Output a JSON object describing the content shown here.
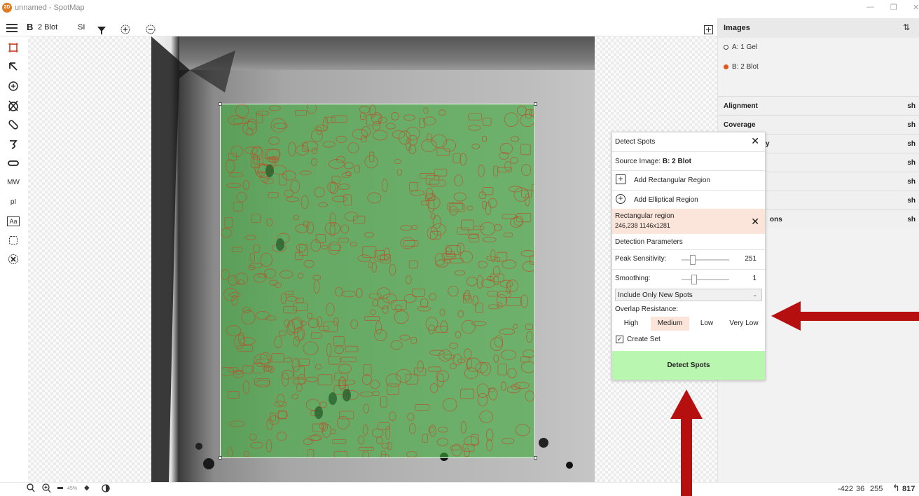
{
  "window": {
    "title": "unnamed - SpotMap",
    "logo_text": "2D",
    "minimize": "—",
    "maximize": "❐",
    "close": "✕"
  },
  "toolbar": {
    "image_letter": "B",
    "image_name": "2 Blot",
    "si_label": "SI"
  },
  "left_tools": {
    "mw_label": "MW",
    "pi_label": "pI",
    "text_label": "Aa"
  },
  "status_bar": {
    "zoom": "45%",
    "readout_x": "-422",
    "readout_y": "36",
    "readout_intensity": "255",
    "spot_count": "817"
  },
  "right_panel": {
    "images_header": "Images",
    "images": [
      {
        "label": "A: 1 Gel",
        "selected": false
      },
      {
        "label": "B: 2 Blot",
        "selected": true
      }
    ],
    "sections": [
      {
        "label": "Alignment",
        "short": "sh"
      },
      {
        "label": "Coverage",
        "short": "sh"
      },
      {
        "label": "y",
        "short": "sh"
      },
      {
        "label": "",
        "short": "sh"
      },
      {
        "label": "",
        "short": "sh"
      },
      {
        "label": "",
        "short": "sh"
      },
      {
        "label": "ons",
        "short": "sh"
      }
    ]
  },
  "dialog": {
    "title": "Detect Spots",
    "source_label": "Source Image:",
    "source_value": "B: 2 Blot",
    "add_rect": "Add Rectangular Region",
    "add_ellipse": "Add Elliptical Region",
    "region_title": "Rectangular region",
    "region_coords": "246,238  1146x1281",
    "params_header": "Detection Parameters",
    "peak_label": "Peak Sensitivity:",
    "peak_value": "251",
    "smoothing_label": "Smoothing:",
    "smoothing_value": "1",
    "spot_mode": "Include Only New Spots",
    "overlap_label": "Overlap Resistance:",
    "overlap_options": [
      "High",
      "Medium",
      "Low",
      "Very Low"
    ],
    "overlap_selected": "Medium",
    "create_set_label": "Create Set",
    "create_set_checked": true,
    "detect_button": "Detect Spots"
  },
  "colors": {
    "accent": "#c83a1a",
    "region_fill": "#3caa3c",
    "spot_outline": "#b5562a",
    "detect_button": "#b9f7b0",
    "selection_highlight": "#fbe4d9",
    "annotation_arrow": "#b50f0f"
  }
}
